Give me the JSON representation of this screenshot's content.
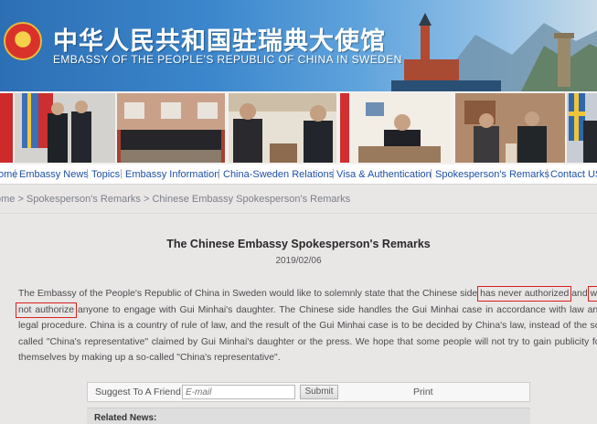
{
  "header": {
    "cn_title": "中华人民共和国驻瑞典大使馆",
    "en_title": "EMBASSY OF THE PEOPLE'S REPUBLIC OF CHINA IN SWEDEN"
  },
  "nav": {
    "items": [
      {
        "label": "ome"
      },
      {
        "label": "Embassy News"
      },
      {
        "label": "Topics"
      },
      {
        "label": "Embassy Information"
      },
      {
        "label": "China-Sweden Relations"
      },
      {
        "label": "Visa & Authentication"
      },
      {
        "label": "Spokesperson's Remarks"
      },
      {
        "label": "Contact US"
      }
    ]
  },
  "breadcrumb": "ome > Spokesperson's Remarks > Chinese Embassy Spokesperson's Remarks",
  "article": {
    "title": "The Chinese Embassy Spokesperson's Remarks",
    "date": "2019/02/06",
    "p_a": "The Embassy of the People's Republic of China in Sweden would like to solemnly state that the Chinese side ",
    "hl_1": "has never authorized",
    "p_b": " and ",
    "hl_2": "will not authorize",
    "p_c": " anyone to engage with Gui Minhai's daughter. The Chinese side handles the Gui Minhai case in accordance with law and legal procedure. China is a country of rule of law, and the result of the Gui Minhai case is to be decided by China's law, instead of the so-called \"China's representative\" claimed by Gui Minhai's daughter or the press. We hope that some people will not try to gain publicity for themselves by making up a so-called \"China's representative\"."
  },
  "share": {
    "label": "Suggest To A Friend",
    "placeholder": "E-mail",
    "submit": "Submit",
    "print": "Print"
  },
  "related": {
    "label": "Related News:"
  },
  "colors": {
    "banner": "#3b86cc",
    "nav_text": "#1f4fa8",
    "highlight_box": "#d9211f"
  }
}
